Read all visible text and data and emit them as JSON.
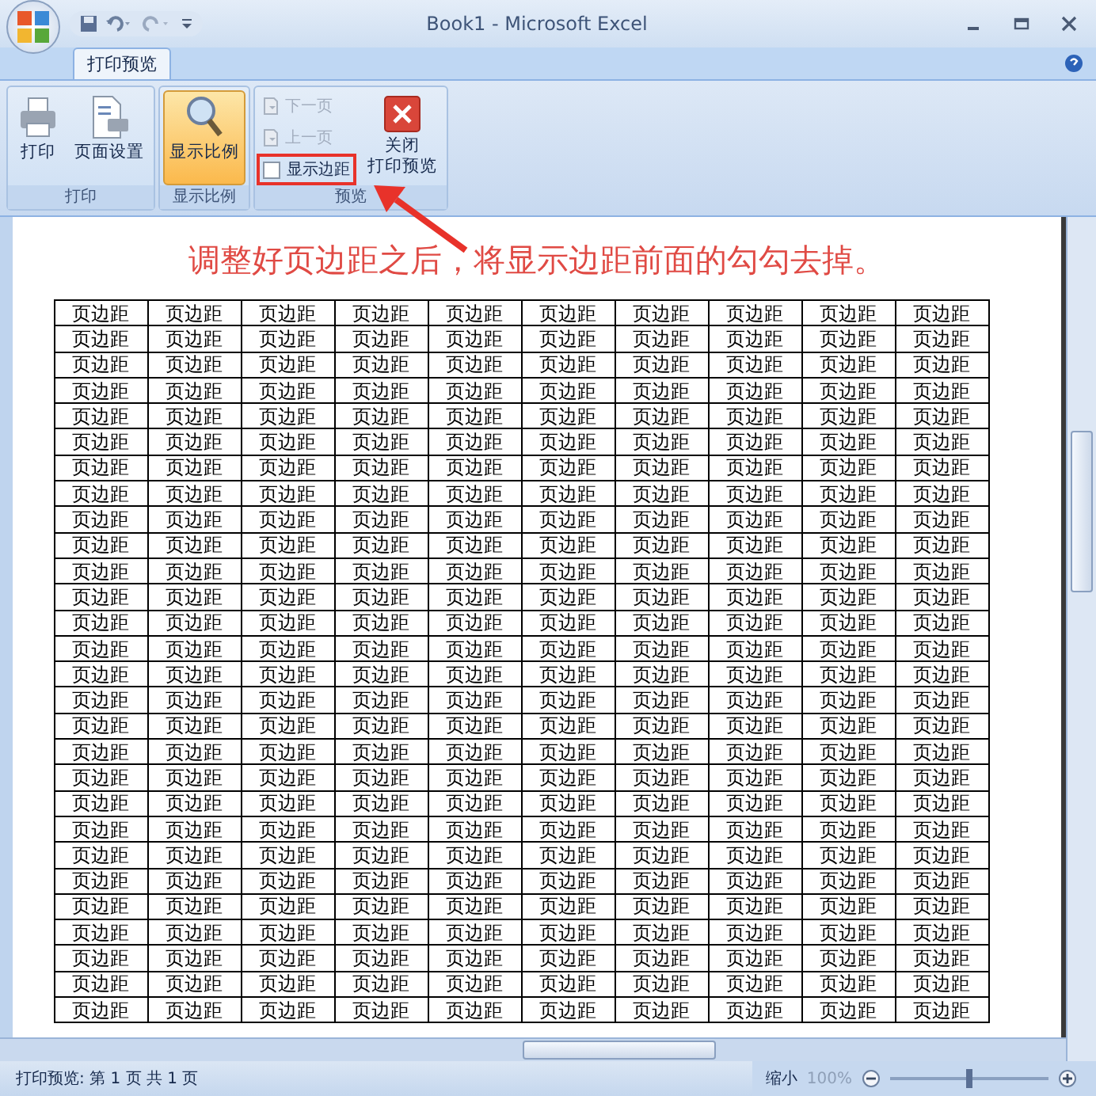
{
  "window": {
    "title": "Book1 - Microsoft Excel"
  },
  "tabs": [
    {
      "label": "打印预览",
      "selected": true
    }
  ],
  "ribbon": {
    "groups": [
      {
        "label": "打印",
        "items": [
          {
            "kind": "large",
            "label": "打印",
            "active": false
          },
          {
            "kind": "large",
            "label": "页面设置",
            "active": false
          }
        ]
      },
      {
        "label": "显示比例",
        "items": [
          {
            "kind": "large",
            "label": "显示比例",
            "active": true
          }
        ]
      },
      {
        "label": "预览",
        "items": [
          {
            "kind": "small",
            "label": "下一页",
            "disabled": true
          },
          {
            "kind": "small",
            "label": "上一页",
            "disabled": true
          },
          {
            "kind": "checkbox",
            "label": "显示边距",
            "checked": false,
            "highlighted": true
          },
          {
            "kind": "large",
            "lines": [
              "关闭",
              "打印预览"
            ],
            "active": false
          }
        ]
      }
    ]
  },
  "annotation": {
    "text": "调整好页边距之后，将显示边距前面的勾勾去掉。"
  },
  "page": {
    "rows": [
      [
        "页边距",
        "页边距",
        "页边距",
        "页边距",
        "页边距",
        "页边距",
        "页边距",
        "页边距",
        "页边距",
        "页边距"
      ],
      [
        "页边距",
        "页边距",
        "页边距",
        "页边距",
        "页边距",
        "页边距",
        "页边距",
        "页边距",
        "页边距",
        "页边距"
      ],
      [
        "页边距",
        "页边距",
        "页边距",
        "页边距",
        "页边距",
        "页边距",
        "页边距",
        "页边距",
        "页边距",
        "页边距"
      ],
      [
        "页边距",
        "页边距",
        "页边距",
        "页边距",
        "页边距",
        "页边距",
        "页边距",
        "页边距",
        "页边距",
        "页边距"
      ],
      [
        "页边距",
        "页边距",
        "页边距",
        "页边距",
        "页边距",
        "页边距",
        "页边距",
        "页边距",
        "页边距",
        "页边距"
      ],
      [
        "页边距",
        "页边距",
        "页边距",
        "页边距",
        "页边距",
        "页边距",
        "页边距",
        "页边距",
        "页边距",
        "页边距"
      ],
      [
        "页边距",
        "页边距",
        "页边距",
        "页边距",
        "页边距",
        "页边距",
        "页边距",
        "页边距",
        "页边距",
        "页边距"
      ],
      [
        "页边距",
        "页边距",
        "页边距",
        "页边距",
        "页边距",
        "页边距",
        "页边距",
        "页边距",
        "页边距",
        "页边距"
      ],
      [
        "页边距",
        "页边距",
        "页边距",
        "页边距",
        "页边距",
        "页边距",
        "页边距",
        "页边距",
        "页边距",
        "页边距"
      ],
      [
        "页边距",
        "页边距",
        "页边距",
        "页边距",
        "页边距",
        "页边距",
        "页边距",
        "页边距",
        "页边距",
        "页边距"
      ],
      [
        "页边距",
        "页边距",
        "页边距",
        "页边距",
        "页边距",
        "页边距",
        "页边距",
        "页边距",
        "页边距",
        "页边距"
      ],
      [
        "页边距",
        "页边距",
        "页边距",
        "页边距",
        "页边距",
        "页边距",
        "页边距",
        "页边距",
        "页边距",
        "页边距"
      ],
      [
        "页边距",
        "页边距",
        "页边距",
        "页边距",
        "页边距",
        "页边距",
        "页边距",
        "页边距",
        "页边距",
        "页边距"
      ],
      [
        "页边距",
        "页边距",
        "页边距",
        "页边距",
        "页边距",
        "页边距",
        "页边距",
        "页边距",
        "页边距",
        "页边距"
      ],
      [
        "页边距",
        "页边距",
        "页边距",
        "页边距",
        "页边距",
        "页边距",
        "页边距",
        "页边距",
        "页边距",
        "页边距"
      ],
      [
        "页边距",
        "页边距",
        "页边距",
        "页边距",
        "页边距",
        "页边距",
        "页边距",
        "页边距",
        "页边距",
        "页边距"
      ],
      [
        "页边距",
        "页边距",
        "页边距",
        "页边距",
        "页边距",
        "页边距",
        "页边距",
        "页边距",
        "页边距",
        "页边距"
      ],
      [
        "页边距",
        "页边距",
        "页边距",
        "页边距",
        "页边距",
        "页边距",
        "页边距",
        "页边距",
        "页边距",
        "页边距"
      ],
      [
        "页边距",
        "页边距",
        "页边距",
        "页边距",
        "页边距",
        "页边距",
        "页边距",
        "页边距",
        "页边距",
        "页边距"
      ],
      [
        "页边距",
        "页边距",
        "页边距",
        "页边距",
        "页边距",
        "页边距",
        "页边距",
        "页边距",
        "页边距",
        "页边距"
      ],
      [
        "页边距",
        "页边距",
        "页边距",
        "页边距",
        "页边距",
        "页边距",
        "页边距",
        "页边距",
        "页边距",
        "页边距"
      ],
      [
        "页边距",
        "页边距",
        "页边距",
        "页边距",
        "页边距",
        "页边距",
        "页边距",
        "页边距",
        "页边距",
        "页边距"
      ],
      [
        "页边距",
        "页边距",
        "页边距",
        "页边距",
        "页边距",
        "页边距",
        "页边距",
        "页边距",
        "页边距",
        "页边距"
      ],
      [
        "页边距",
        "页边距",
        "页边距",
        "页边距",
        "页边距",
        "页边距",
        "页边距",
        "页边距",
        "页边距",
        "页边距"
      ],
      [
        "页边距",
        "页边距",
        "页边距",
        "页边距",
        "页边距",
        "页边距",
        "页边距",
        "页边距",
        "页边距",
        "页边距"
      ],
      [
        "页边距",
        "页边距",
        "页边距",
        "页边距",
        "页边距",
        "页边距",
        "页边距",
        "页边距",
        "页边距",
        "页边距"
      ],
      [
        "页边距",
        "页边距",
        "页边距",
        "页边距",
        "页边距",
        "页边距",
        "页边距",
        "页边距",
        "页边距",
        "页边距"
      ],
      [
        "页边距",
        "页边距",
        "页边距",
        "页边距",
        "页边距",
        "页边距",
        "页边距",
        "页边距",
        "页边距",
        "页边距"
      ]
    ]
  },
  "status_bar": {
    "text": "打印预览: 第 1 页  共 1 页",
    "zoom_label": "缩小",
    "zoom_value": "100%",
    "level": 0.5
  }
}
